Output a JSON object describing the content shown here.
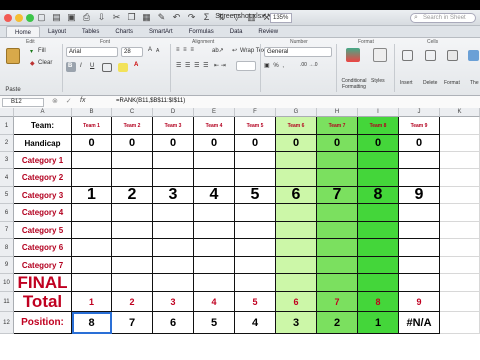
{
  "window": {
    "title": "Screenshot.xlsx",
    "zoom": "135%",
    "search_placeholder": "Search in Sheet"
  },
  "colors": {
    "light_green": "#ccf7a8",
    "mid_green": "#7be05f",
    "bright_green": "#44d63a",
    "red_text": "#c00020",
    "team_red": "#b3001f"
  },
  "ribbon": {
    "tabs": [
      "Home",
      "Layout",
      "Tables",
      "Charts",
      "SmartArt",
      "Formulas",
      "Data",
      "Review"
    ],
    "groups": {
      "edit": "Edit",
      "font": "Font",
      "alignment": "Alignment",
      "number": "Number",
      "format": "Format",
      "cells": "Cells"
    },
    "paste_label": "Paste",
    "fill_label": "Fill",
    "clear_label": "Clear",
    "font_name": "Arial",
    "font_size": "28",
    "wrap_text_label": "Wrap Text",
    "number_format": "General",
    "cond_format_label": "Conditional Formatting",
    "styles_label": "Styles",
    "insert_label": "Insert",
    "delete_label": "Delete",
    "format_label": "Format",
    "themes_label": "The"
  },
  "formula_bar": {
    "name_box": "B12",
    "formula": "=RANK(B11,$B$11:$I$11)"
  },
  "sheet": {
    "col_headers": [
      "A",
      "B",
      "C",
      "D",
      "E",
      "F",
      "G",
      "H",
      "I",
      "J",
      "K"
    ],
    "teams": [
      "Team 1",
      "Team 2",
      "Team 3",
      "Team 4",
      "Team 5",
      "Team 6",
      "Team 7",
      "Team 8",
      "Team 9"
    ],
    "row_labels": {
      "team": "Team:",
      "handicap": "Handicap",
      "cat1": "Category 1",
      "cat2": "Category 2",
      "cat3": "Category 3",
      "cat4": "Category 4",
      "cat5": "Category 5",
      "cat6": "Category 6",
      "cat7": "Category 7",
      "final": "FINAL",
      "total": "Total",
      "position": "Position:"
    },
    "handicap": [
      "0",
      "0",
      "0",
      "0",
      "0",
      "0",
      "0",
      "0",
      "0"
    ],
    "category3": [
      "1",
      "2",
      "3",
      "4",
      "5",
      "6",
      "7",
      "8",
      "9"
    ],
    "totals": [
      "1",
      "2",
      "3",
      "4",
      "5",
      "6",
      "7",
      "8",
      "9"
    ],
    "positions": [
      "8",
      "7",
      "6",
      "5",
      "4",
      "3",
      "2",
      "1",
      "#N/A"
    ]
  }
}
